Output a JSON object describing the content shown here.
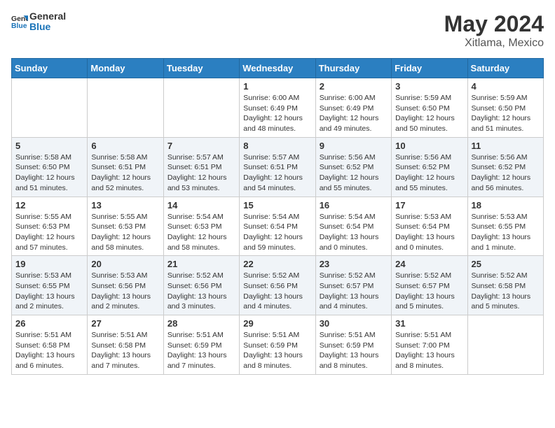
{
  "header": {
    "logo_line1": "General",
    "logo_line2": "Blue",
    "month": "May 2024",
    "location": "Xitlama, Mexico"
  },
  "weekdays": [
    "Sunday",
    "Monday",
    "Tuesday",
    "Wednesday",
    "Thursday",
    "Friday",
    "Saturday"
  ],
  "weeks": [
    [
      {
        "day": "",
        "info": ""
      },
      {
        "day": "",
        "info": ""
      },
      {
        "day": "",
        "info": ""
      },
      {
        "day": "1",
        "info": "Sunrise: 6:00 AM\nSunset: 6:49 PM\nDaylight: 12 hours\nand 48 minutes."
      },
      {
        "day": "2",
        "info": "Sunrise: 6:00 AM\nSunset: 6:49 PM\nDaylight: 12 hours\nand 49 minutes."
      },
      {
        "day": "3",
        "info": "Sunrise: 5:59 AM\nSunset: 6:50 PM\nDaylight: 12 hours\nand 50 minutes."
      },
      {
        "day": "4",
        "info": "Sunrise: 5:59 AM\nSunset: 6:50 PM\nDaylight: 12 hours\nand 51 minutes."
      }
    ],
    [
      {
        "day": "5",
        "info": "Sunrise: 5:58 AM\nSunset: 6:50 PM\nDaylight: 12 hours\nand 51 minutes."
      },
      {
        "day": "6",
        "info": "Sunrise: 5:58 AM\nSunset: 6:51 PM\nDaylight: 12 hours\nand 52 minutes."
      },
      {
        "day": "7",
        "info": "Sunrise: 5:57 AM\nSunset: 6:51 PM\nDaylight: 12 hours\nand 53 minutes."
      },
      {
        "day": "8",
        "info": "Sunrise: 5:57 AM\nSunset: 6:51 PM\nDaylight: 12 hours\nand 54 minutes."
      },
      {
        "day": "9",
        "info": "Sunrise: 5:56 AM\nSunset: 6:52 PM\nDaylight: 12 hours\nand 55 minutes."
      },
      {
        "day": "10",
        "info": "Sunrise: 5:56 AM\nSunset: 6:52 PM\nDaylight: 12 hours\nand 55 minutes."
      },
      {
        "day": "11",
        "info": "Sunrise: 5:56 AM\nSunset: 6:52 PM\nDaylight: 12 hours\nand 56 minutes."
      }
    ],
    [
      {
        "day": "12",
        "info": "Sunrise: 5:55 AM\nSunset: 6:53 PM\nDaylight: 12 hours\nand 57 minutes."
      },
      {
        "day": "13",
        "info": "Sunrise: 5:55 AM\nSunset: 6:53 PM\nDaylight: 12 hours\nand 58 minutes."
      },
      {
        "day": "14",
        "info": "Sunrise: 5:54 AM\nSunset: 6:53 PM\nDaylight: 12 hours\nand 58 minutes."
      },
      {
        "day": "15",
        "info": "Sunrise: 5:54 AM\nSunset: 6:54 PM\nDaylight: 12 hours\nand 59 minutes."
      },
      {
        "day": "16",
        "info": "Sunrise: 5:54 AM\nSunset: 6:54 PM\nDaylight: 13 hours\nand 0 minutes."
      },
      {
        "day": "17",
        "info": "Sunrise: 5:53 AM\nSunset: 6:54 PM\nDaylight: 13 hours\nand 0 minutes."
      },
      {
        "day": "18",
        "info": "Sunrise: 5:53 AM\nSunset: 6:55 PM\nDaylight: 13 hours\nand 1 minute."
      }
    ],
    [
      {
        "day": "19",
        "info": "Sunrise: 5:53 AM\nSunset: 6:55 PM\nDaylight: 13 hours\nand 2 minutes."
      },
      {
        "day": "20",
        "info": "Sunrise: 5:53 AM\nSunset: 6:56 PM\nDaylight: 13 hours\nand 2 minutes."
      },
      {
        "day": "21",
        "info": "Sunrise: 5:52 AM\nSunset: 6:56 PM\nDaylight: 13 hours\nand 3 minutes."
      },
      {
        "day": "22",
        "info": "Sunrise: 5:52 AM\nSunset: 6:56 PM\nDaylight: 13 hours\nand 4 minutes."
      },
      {
        "day": "23",
        "info": "Sunrise: 5:52 AM\nSunset: 6:57 PM\nDaylight: 13 hours\nand 4 minutes."
      },
      {
        "day": "24",
        "info": "Sunrise: 5:52 AM\nSunset: 6:57 PM\nDaylight: 13 hours\nand 5 minutes."
      },
      {
        "day": "25",
        "info": "Sunrise: 5:52 AM\nSunset: 6:58 PM\nDaylight: 13 hours\nand 5 minutes."
      }
    ],
    [
      {
        "day": "26",
        "info": "Sunrise: 5:51 AM\nSunset: 6:58 PM\nDaylight: 13 hours\nand 6 minutes."
      },
      {
        "day": "27",
        "info": "Sunrise: 5:51 AM\nSunset: 6:58 PM\nDaylight: 13 hours\nand 7 minutes."
      },
      {
        "day": "28",
        "info": "Sunrise: 5:51 AM\nSunset: 6:59 PM\nDaylight: 13 hours\nand 7 minutes."
      },
      {
        "day": "29",
        "info": "Sunrise: 5:51 AM\nSunset: 6:59 PM\nDaylight: 13 hours\nand 8 minutes."
      },
      {
        "day": "30",
        "info": "Sunrise: 5:51 AM\nSunset: 6:59 PM\nDaylight: 13 hours\nand 8 minutes."
      },
      {
        "day": "31",
        "info": "Sunrise: 5:51 AM\nSunset: 7:00 PM\nDaylight: 13 hours\nand 8 minutes."
      },
      {
        "day": "",
        "info": ""
      }
    ]
  ]
}
